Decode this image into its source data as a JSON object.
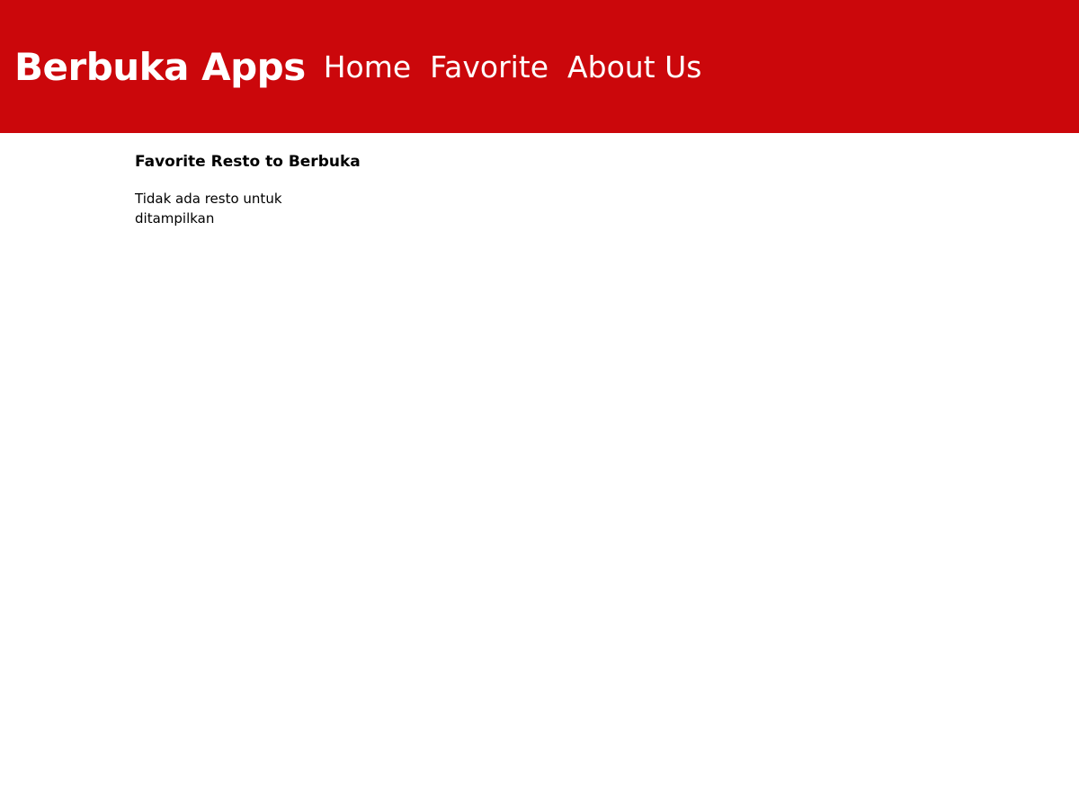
{
  "header": {
    "brand": "Berbuka Apps",
    "nav": {
      "home": "Home",
      "favorite": "Favorite",
      "about": "About Us"
    },
    "background_color": "#cb070b"
  },
  "main": {
    "title": "Favorite Resto to Berbuka",
    "empty_message": "Tidak ada resto untuk ditampilkan"
  }
}
